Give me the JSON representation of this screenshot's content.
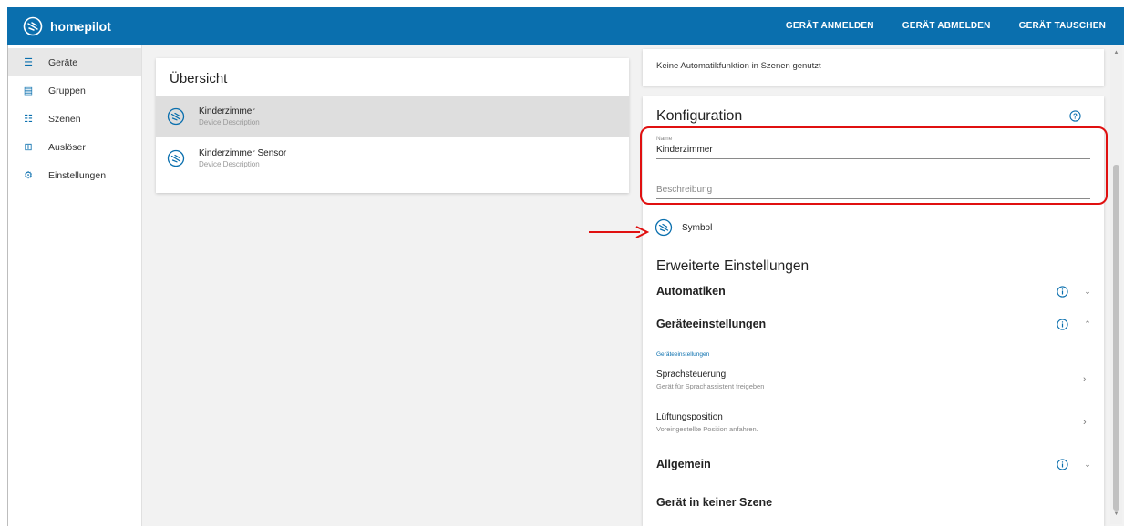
{
  "app": {
    "brand": "homepilot"
  },
  "topbar": {
    "actions": [
      "GERÄT ANMELDEN",
      "GERÄT ABMELDEN",
      "GERÄT TAUSCHEN"
    ]
  },
  "sidebar": {
    "items": [
      {
        "label": "Geräte",
        "icon": "list-icon"
      },
      {
        "label": "Gruppen",
        "icon": "groups-icon"
      },
      {
        "label": "Szenen",
        "icon": "scenes-icon"
      },
      {
        "label": "Auslöser",
        "icon": "trigger-icon"
      },
      {
        "label": "Einstellungen",
        "icon": "gear-icon"
      }
    ]
  },
  "overview": {
    "title": "Übersicht",
    "devices": [
      {
        "name": "Kinderzimmer",
        "description": "Device Description"
      },
      {
        "name": "Kinderzimmer Sensor",
        "description": "Device Description"
      }
    ]
  },
  "info_card": {
    "text": "Keine Automatikfunktion in Szenen genutzt"
  },
  "config": {
    "title": "Konfiguration",
    "name_label": "Name",
    "name_value": "Kinderzimmer",
    "description_placeholder": "Beschreibung",
    "symbol_label": "Symbol",
    "advanced_title": "Erweiterte Einstellungen",
    "sections": {
      "automatiken": "Automatiken",
      "geraeteeinstellungen": "Geräteeinstellungen",
      "allgemein": "Allgemein",
      "szene": "Gerät in keiner Szene"
    },
    "subhead": "Geräteeinstellungen",
    "sub_items": [
      {
        "name": "Sprachsteuerung",
        "description": "Gerät für Sprachassistent freigeben"
      },
      {
        "name": "Lüftungsposition",
        "description": "Voreingestellte Position anfahren."
      }
    ]
  },
  "colors": {
    "brand": "#0a6fae",
    "highlight": "#e01010"
  }
}
